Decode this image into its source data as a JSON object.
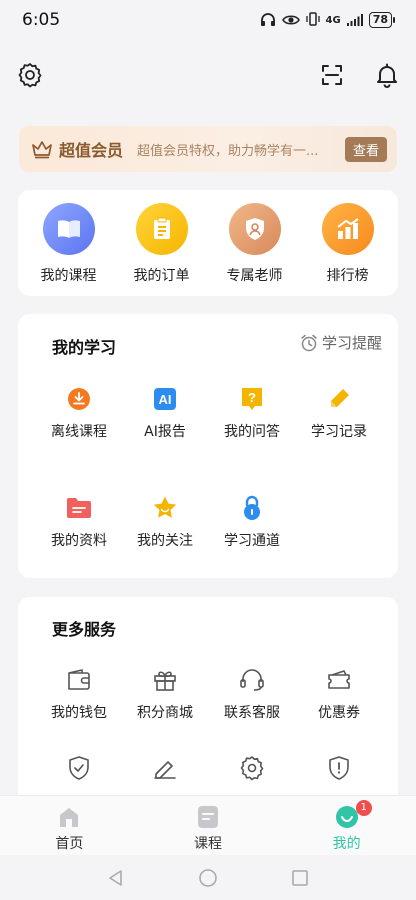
{
  "status_bar": {
    "time": "6:05",
    "signal_label": "4G",
    "battery": "78"
  },
  "vip": {
    "title": "超值会员",
    "description": "超值会员特权，助力畅学有一...",
    "button": "查看"
  },
  "quick_actions": [
    {
      "label": "我的课程",
      "icon": "book-icon"
    },
    {
      "label": "我的订单",
      "icon": "order-clipboard-icon"
    },
    {
      "label": "专属老师",
      "icon": "teacher-shield-icon"
    },
    {
      "label": "排行榜",
      "icon": "ranking-chart-icon"
    }
  ],
  "study": {
    "title": "我的学习",
    "reminder": "学习提醒",
    "items": [
      {
        "label": "离线课程",
        "icon": "download-icon"
      },
      {
        "label": "AI报告",
        "icon": "ai-report-icon"
      },
      {
        "label": "我的问答",
        "icon": "question-icon"
      },
      {
        "label": "学习记录",
        "icon": "pencil-icon"
      },
      {
        "label": "我的资料",
        "icon": "folder-icon"
      },
      {
        "label": "我的关注",
        "icon": "star-icon"
      },
      {
        "label": "学习通道",
        "icon": "lock-icon"
      }
    ]
  },
  "services": {
    "title": "更多服务",
    "items": [
      {
        "label": "我的钱包",
        "icon": "wallet-icon"
      },
      {
        "label": "积分商城",
        "icon": "gift-icon"
      },
      {
        "label": "联系客服",
        "icon": "headset-icon"
      },
      {
        "label": "优惠券",
        "icon": "coupon-icon"
      },
      {
        "label": "",
        "icon": "shield-check-icon"
      },
      {
        "label": "",
        "icon": "edit-icon"
      },
      {
        "label": "",
        "icon": "settings-icon"
      },
      {
        "label": "",
        "icon": "alert-shield-icon"
      }
    ]
  },
  "bottom_nav": {
    "items": [
      {
        "label": "首页",
        "icon": "home-icon"
      },
      {
        "label": "课程",
        "icon": "course-icon"
      },
      {
        "label": "我的",
        "icon": "profile-icon"
      }
    ],
    "badge": "1",
    "active_color": "#31c4a7"
  }
}
